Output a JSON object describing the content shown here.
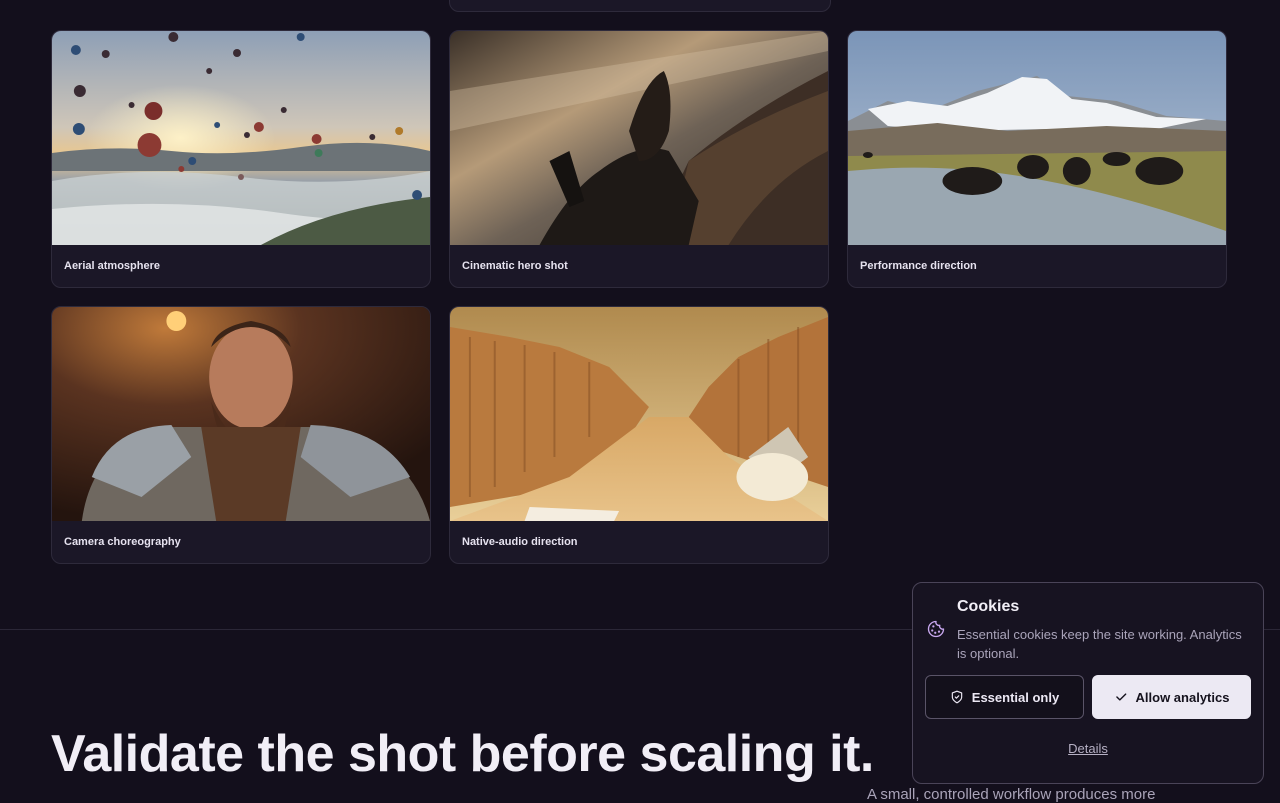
{
  "gallery": {
    "cards": [
      {
        "caption": "Aerial atmosphere",
        "image": "hot-air-balloons-over-misty-valley"
      },
      {
        "caption": "Cinematic hero shot",
        "image": "rider-on-dragon-back"
      },
      {
        "caption": "Performance direction",
        "image": "yaks-at-mountain-river"
      },
      {
        "caption": "Camera choreography",
        "image": "bearded-armored-warrior"
      },
      {
        "caption": "Native-audio direction",
        "image": "desert-canyon-with-lamp"
      }
    ]
  },
  "section": {
    "headline": "Validate the shot before scaling it.",
    "lede": "A small, controlled workflow produces more"
  },
  "cookie_banner": {
    "title": "Cookies",
    "body": "Essential cookies keep the site working. Analytics is optional.",
    "essential_label": "Essential only",
    "allow_label": "Allow analytics",
    "details_label": "Details",
    "icon": "cookie-icon"
  },
  "colors": {
    "background": "#130f1c",
    "card": "#1b1727",
    "accent_light": "#ece9f3",
    "cookie_icon": "#c9a8f0"
  }
}
